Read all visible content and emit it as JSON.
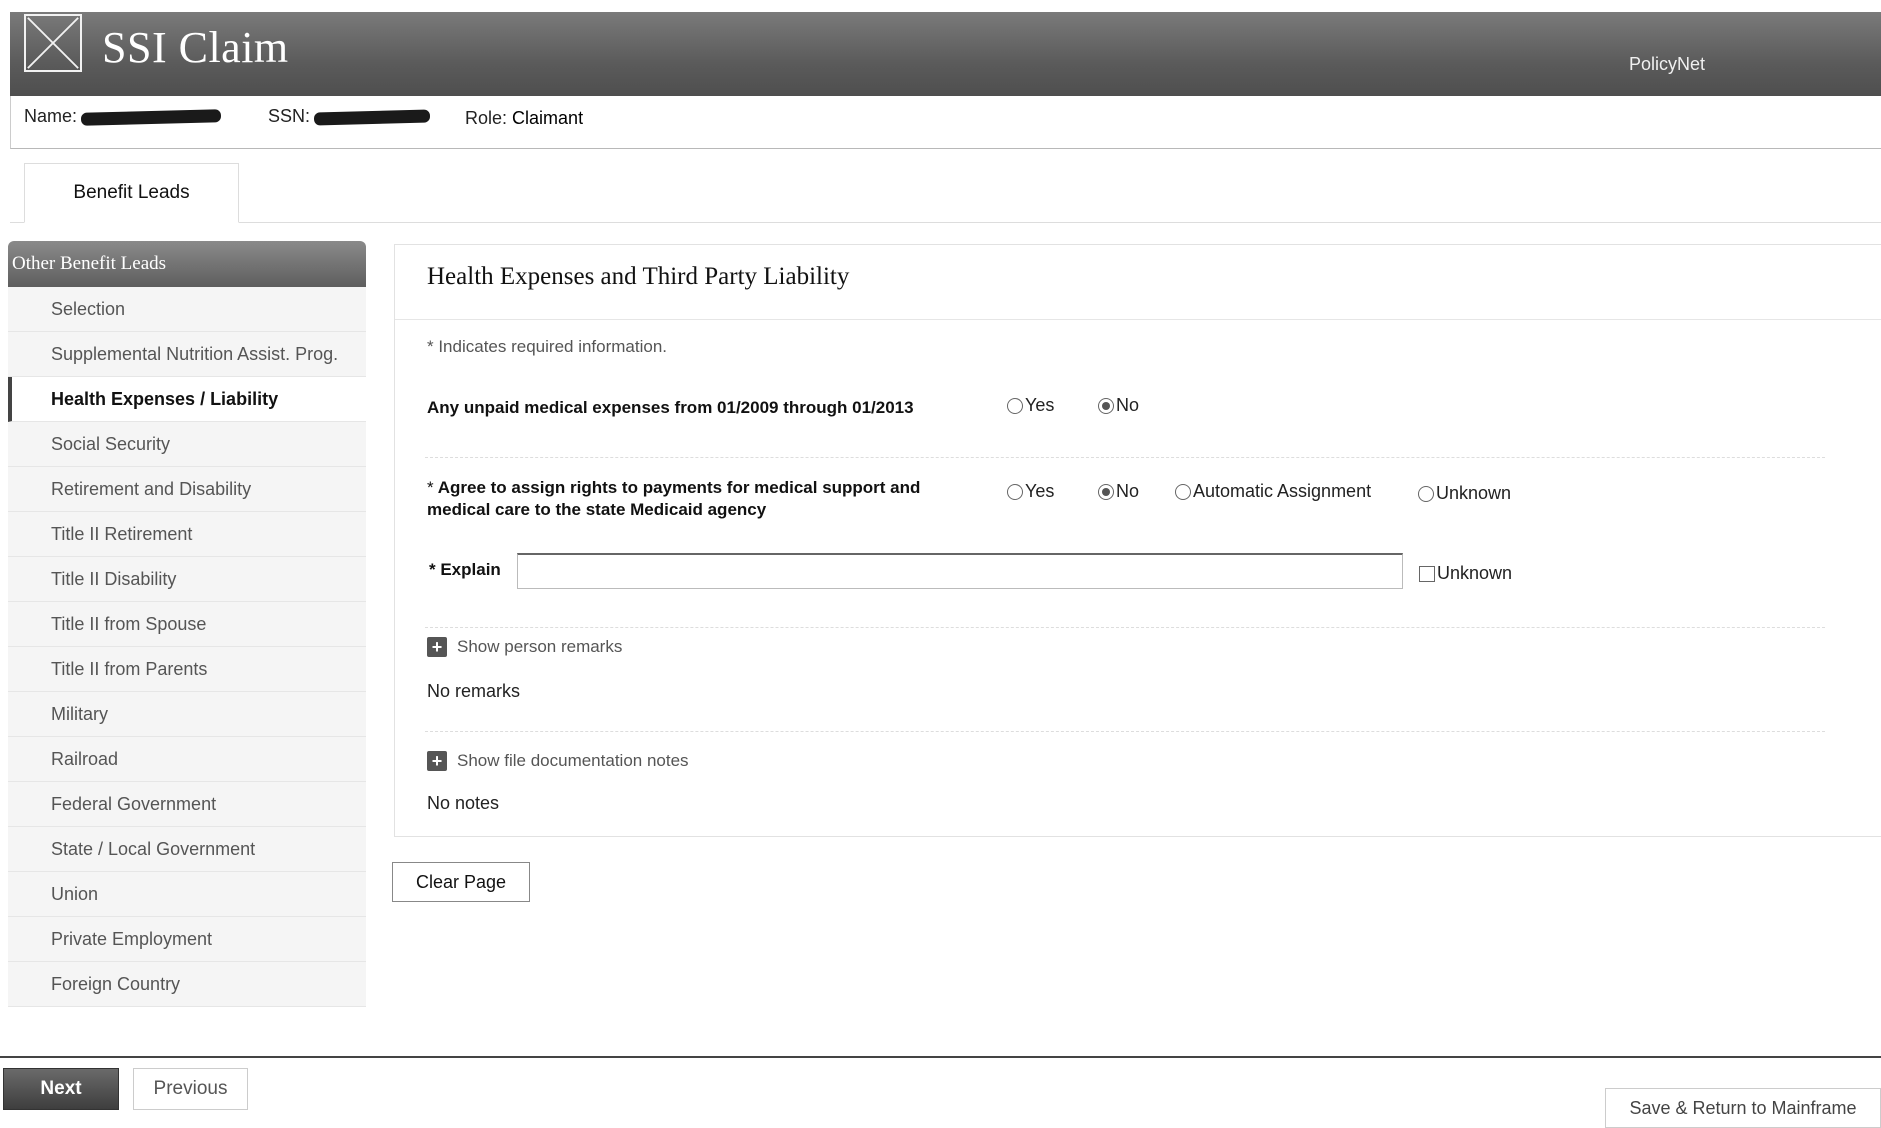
{
  "header": {
    "logo_icon": "app-logo-x-icon",
    "title": "SSI Claim",
    "link": "PolicyNet"
  },
  "claimant": {
    "name_label": "Name:",
    "ssn_label": "SSN:",
    "role_label": "Role:",
    "role_value": "Claimant"
  },
  "tabs": [
    {
      "label": "Benefit Leads"
    }
  ],
  "sidebar": {
    "title": "Other Benefit Leads",
    "items": [
      {
        "label": "Selection"
      },
      {
        "label": "Supplemental Nutrition Assist. Prog."
      },
      {
        "label": "Health Expenses / Liability",
        "active": true
      },
      {
        "label": "Social Security"
      },
      {
        "label": "Retirement and Disability"
      },
      {
        "label": "Title II Retirement"
      },
      {
        "label": "Title II Disability"
      },
      {
        "label": "Title II from Spouse"
      },
      {
        "label": "Title II from Parents"
      },
      {
        "label": "Military"
      },
      {
        "label": "Railroad"
      },
      {
        "label": "Federal Government"
      },
      {
        "label": "State / Local Government"
      },
      {
        "label": "Union"
      },
      {
        "label": "Private Employment"
      },
      {
        "label": "Foreign Country"
      }
    ]
  },
  "main": {
    "title": "Health Expenses and Third Party Liability",
    "required_note": "* Indicates required information.",
    "q1": {
      "label": "Any unpaid medical expenses from 01/2009 through 01/2013",
      "options": [
        "Yes",
        "No"
      ],
      "selected": "No"
    },
    "q2": {
      "label_star": "*",
      "label_line1": "Agree to assign rights to payments for medical support and",
      "label_line2": "medical care to the state Medicaid agency",
      "options": [
        "Yes",
        "No",
        "Automatic Assignment",
        "Unknown"
      ],
      "selected": "No"
    },
    "explain": {
      "label": "* Explain",
      "value": "",
      "unknown_label": "Unknown",
      "unknown_checked": false
    },
    "person_remarks": {
      "toggle_label": "Show person remarks",
      "content": "No remarks"
    },
    "file_notes": {
      "toggle_label": "Show file documentation notes",
      "content": "No notes"
    },
    "clear_button": "Clear Page"
  },
  "footer": {
    "next_button": "Next",
    "previous_button": "Previous",
    "save_button": "Save & Return to Mainframe"
  }
}
